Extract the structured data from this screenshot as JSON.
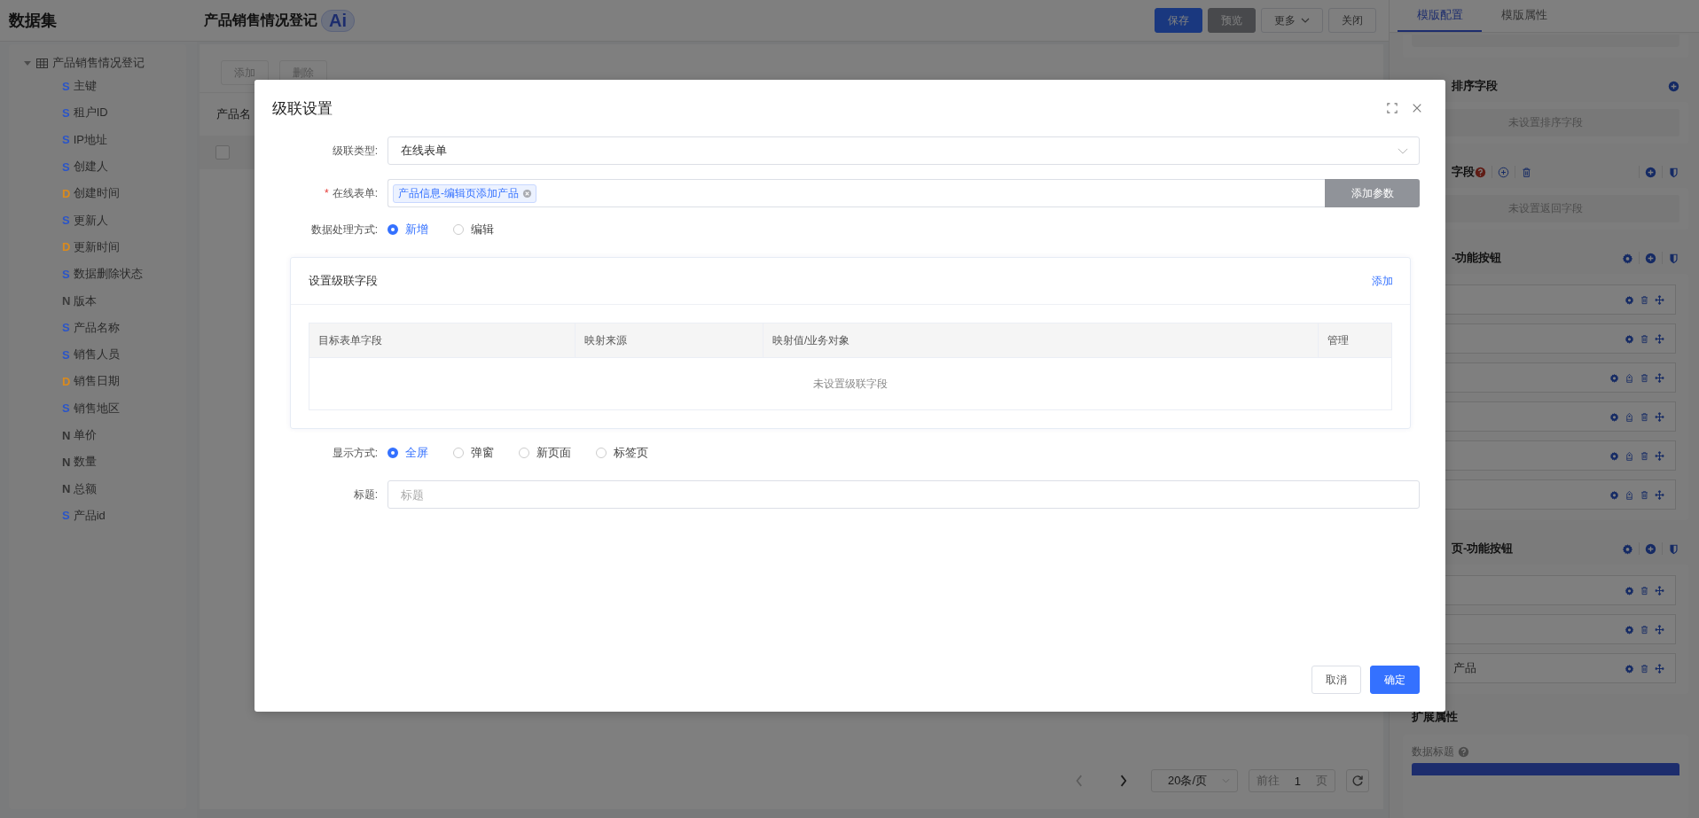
{
  "left": {
    "title": "数据集",
    "tree": [
      {
        "label": "产品销售情况登记",
        "expanded": true,
        "children": [
          {
            "type": "S",
            "label": "主键",
            "color": "#2b55c8"
          },
          {
            "type": "S",
            "label": "租户ID",
            "color": "#2b55c8"
          },
          {
            "type": "S",
            "label": "IP地址",
            "color": "#2b55c8"
          },
          {
            "type": "S",
            "label": "创建人",
            "color": "#2b55c8"
          },
          {
            "type": "D",
            "label": "创建时间",
            "color": "#d98a1e"
          },
          {
            "type": "S",
            "label": "更新人",
            "color": "#2b55c8"
          },
          {
            "type": "D",
            "label": "更新时间",
            "color": "#d98a1e"
          },
          {
            "type": "S",
            "label": "数据删除状态",
            "color": "#2b55c8"
          },
          {
            "type": "N",
            "label": "版本",
            "color": "#3a3a3a"
          },
          {
            "type": "S",
            "label": "产品名称",
            "color": "#2b55c8"
          },
          {
            "type": "S",
            "label": "销售人员",
            "color": "#2b55c8"
          },
          {
            "type": "D",
            "label": "销售日期",
            "color": "#d98a1e"
          },
          {
            "type": "S",
            "label": "销售地区",
            "color": "#2b55c8"
          },
          {
            "type": "N",
            "label": "单价",
            "color": "#333333"
          },
          {
            "type": "N",
            "label": "数量",
            "color": "#333333"
          },
          {
            "type": "N",
            "label": "总额",
            "color": "#333333"
          },
          {
            "type": "S",
            "label": "产品id",
            "color": "#2b55c8"
          }
        ]
      }
    ]
  },
  "header": {
    "title": "产品销售情况登记",
    "badge": "Ai",
    "buttons": [
      {
        "label": "保存",
        "kind": "primary"
      },
      {
        "label": "预览",
        "kind": "info"
      },
      {
        "label": "更多",
        "kind": "dropdown"
      },
      {
        "label": "关闭",
        "kind": "default"
      }
    ]
  },
  "center": {
    "toolbar": [
      {
        "label": "添加",
        "disabled": true
      },
      {
        "label": "删除",
        "disabled": true
      }
    ],
    "filter_label": "产品名",
    "header_checkbox": {
      "checked": false
    },
    "pagination": {
      "page_size": "20条/页",
      "goto_label": "前往",
      "page": "1",
      "page_suffix": "页"
    }
  },
  "right_panel": {
    "tabs": [
      {
        "label": "模版配置",
        "selected": true
      },
      {
        "label": "模版属性",
        "selected": false
      }
    ],
    "sections": [
      {
        "kind": "sort",
        "title": "排序字段",
        "empty": "未设置排序字段"
      },
      {
        "kind": "return",
        "title": "字段",
        "empty": "未设置返回字段"
      },
      {
        "kind": "buttons",
        "title": "-功能按钮",
        "rows": [
          {
            "tagged": false
          },
          {
            "tagged": false
          },
          {
            "tagged": true
          },
          {
            "tagged": true
          },
          {
            "tagged": true
          },
          {
            "tagged": true
          }
        ]
      },
      {
        "kind": "buttons",
        "title": "页-功能按钮",
        "rows": [
          {
            "tagged": false
          },
          {
            "tagged": false
          },
          {
            "tagged": false,
            "label": "产品"
          }
        ]
      }
    ],
    "extended": {
      "title": "扩展属性",
      "field_label": "数据标题"
    }
  },
  "dialog": {
    "title": "级联设置",
    "cascade_type": {
      "label": "级联类型:",
      "value": "在线表单"
    },
    "online_form": {
      "label": "在线表单:",
      "required_mark": "*",
      "tags": [
        "产品信息-编辑页添加产品"
      ],
      "button": "添加参数"
    },
    "processing": {
      "label": "数据处理方式:",
      "options": [
        {
          "label": "新增",
          "selected": true
        },
        {
          "label": "编辑",
          "selected": false
        }
      ]
    },
    "fields_card": {
      "title": "设置级联字段",
      "action": "添加",
      "columns": [
        "目标表单字段",
        "映射来源",
        "映射值/业务对象",
        "管理"
      ],
      "empty": "未设置级联字段"
    },
    "display": {
      "label": "显示方式:",
      "options": [
        {
          "label": "全屏",
          "selected": true
        },
        {
          "label": "弹窗",
          "selected": false
        },
        {
          "label": "新页面",
          "selected": false
        },
        {
          "label": "标签页",
          "selected": false
        }
      ]
    },
    "title_field": {
      "label": "标题:",
      "placeholder": "标题"
    },
    "buttons": [
      {
        "label": "取消",
        "kind": "default"
      },
      {
        "label": "确定",
        "kind": "primary"
      }
    ]
  }
}
